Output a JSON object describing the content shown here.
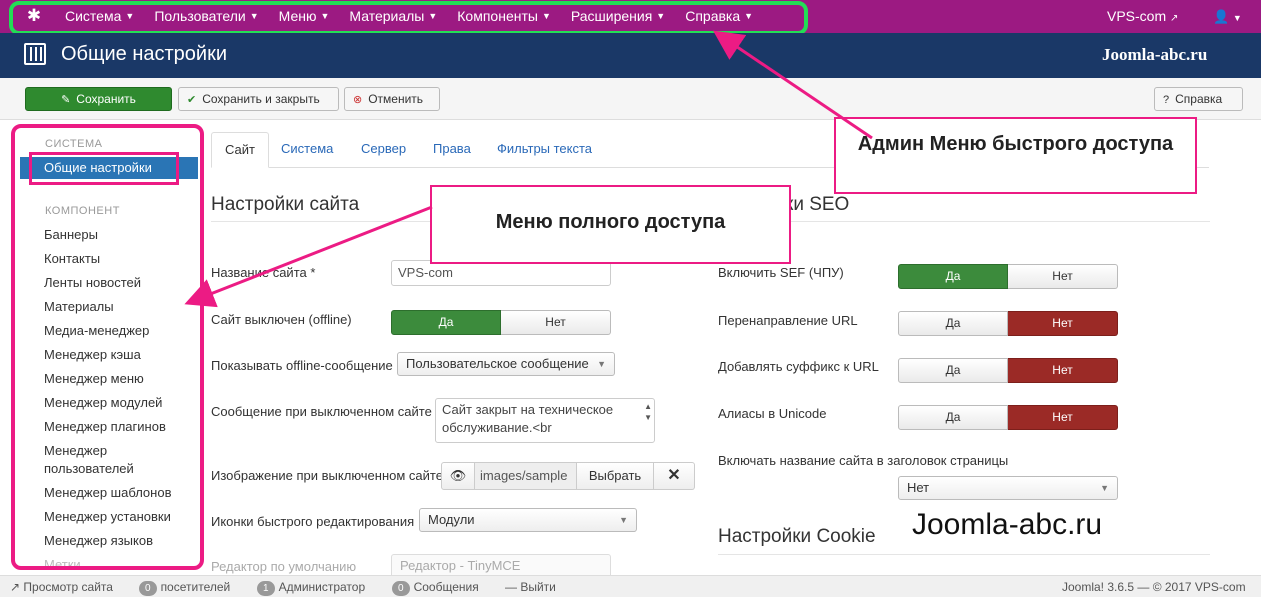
{
  "topbar": {
    "menu": [
      "Система",
      "Пользователи",
      "Меню",
      "Материалы",
      "Компоненты",
      "Расширения",
      "Справка"
    ],
    "site": "VPS-com",
    "colors": {
      "bar": "#9c1a82",
      "outline": "#22dd55"
    }
  },
  "titlebar": {
    "title": "Общие настройки",
    "brand": "Joomla-abc.ru"
  },
  "toolbar": {
    "save": "Сохранить",
    "save_close": "Сохранить и закрыть",
    "cancel": "Отменить",
    "help": "Справка"
  },
  "sidebar": {
    "system_header": "СИСТЕМА",
    "active": "Общие настройки",
    "component_header": "КОМПОНЕНТ",
    "items": [
      "Баннеры",
      "Контакты",
      "Ленты новостей",
      "Материалы",
      "Медиа-менеджер",
      "Менеджер кэша",
      "Менеджер меню",
      "Менеджер модулей",
      "Менеджер плагинов",
      "Менеджер пользователей",
      "Менеджер шаблонов",
      "Менеджер установки",
      "Менеджер языков",
      "Метки"
    ]
  },
  "tabs": [
    "Сайт",
    "Система",
    "Сервер",
    "Права",
    "Фильтры текста"
  ],
  "site": {
    "heading": "Настройки сайта",
    "name_label": "Название сайта *",
    "name_value": "VPS-com",
    "offline_label": "Сайт выключен (offline)",
    "yes": "Да",
    "no": "Нет",
    "show_offline_label": "Показывать offline-сообщение",
    "show_offline_value": "Пользовательское сообщение",
    "offline_msg_label": "Сообщение при выключенном сайте",
    "offline_msg_value": "Сайт закрыт на техническое обслуживание.<br",
    "offline_img_label": "Изображение при выключенном сайте",
    "offline_img_value": "images/sample",
    "choose": "Выбрать",
    "quick_edit_label": "Иконки быстрого редактирования",
    "quick_edit_value": "Модули",
    "editor_label": "Редактор по умолчанию",
    "editor_value": "Редактор - TinyMCE"
  },
  "seo": {
    "heading": "ки SEO",
    "sef_label": "Включить SEF (ЧПУ)",
    "rewrite_label": "Перенаправление URL",
    "suffix_label": "Добавлять суффикс к URL",
    "unicode_label": "Алиасы в Unicode",
    "sitename_label": "Включать название сайта в заголовок страницы",
    "sitename_value": "Нет"
  },
  "cookie": {
    "heading": "Настройки Cookie"
  },
  "callouts": {
    "admin_menu": "Админ Меню быстрого доступа",
    "full_menu": "Меню полного доступа",
    "brand": "Joomla-abc.ru",
    "color": "#ec1b84"
  },
  "footer": {
    "view_site": "Просмотр сайта",
    "visitors_count": "0",
    "visitors": "посетителей",
    "admins_count": "1",
    "admins": "Администратор",
    "messages_count": "0",
    "messages": "Сообщения",
    "logout": "Выйти",
    "version": "Joomla! 3.6.5  — © 2017 VPS-com"
  }
}
